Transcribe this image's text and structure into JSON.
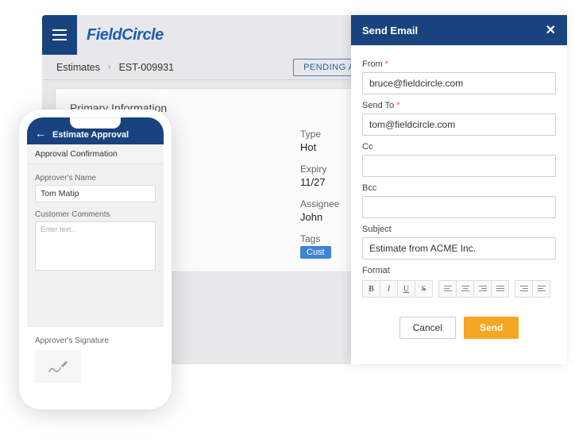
{
  "desktop": {
    "logo": "FieldCircle",
    "breadcrumb": {
      "root": "Estimates",
      "id": "EST-009931"
    },
    "status": "PENDING APPROVAL",
    "card_title": "Primary Information",
    "details": {
      "type_label": "Type",
      "type_value": "Hot",
      "expiry_label": "Expiry",
      "expiry_value": "11/27",
      "assignee_label": "Assignee",
      "assignee_value": "John",
      "tags_label": "Tags",
      "tags_chip": "Cust"
    }
  },
  "email": {
    "title": "Send Email",
    "from_label": "From",
    "from_value": "bruce@fieldcircle.com",
    "sendto_label": "Send To",
    "sendto_value": "tom@fieldcircle.com",
    "cc_label": "Cc",
    "cc_value": "",
    "bcc_label": "Bcc",
    "bcc_value": "",
    "subject_label": "Subject",
    "subject_value": "Estimate from ACME Inc.",
    "format_label": "Format",
    "cancel": "Cancel",
    "send": "Send"
  },
  "phone": {
    "header": "Estimate Approval",
    "section": "Approval Confirmation",
    "approver_label": "Approver's Name",
    "approver_value": "Tom Matip",
    "comments_label": "Customer Comments",
    "comments_placeholder": "Enter text..",
    "sig_label": "Approver's Signature"
  }
}
